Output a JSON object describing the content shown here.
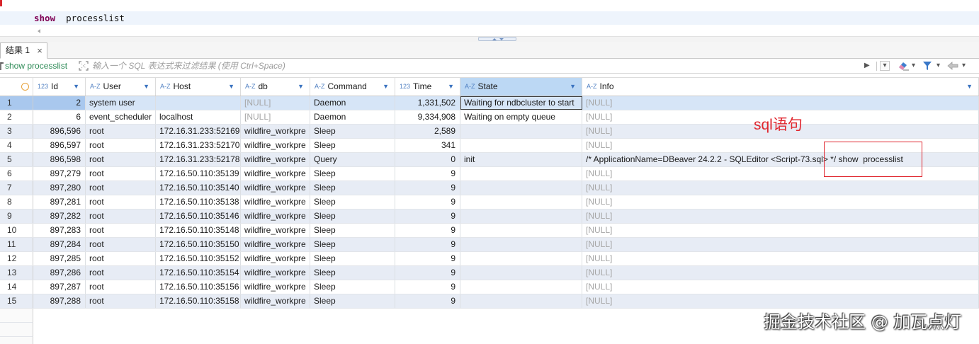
{
  "editor": {
    "keyword": "show",
    "rest": "  processlist"
  },
  "results_tab": {
    "label": "结果 1"
  },
  "filter_bar": {
    "query_label": "show processlist",
    "placeholder": "输入一个 SQL 表达式来过滤结果 (使用 Ctrl+Space)",
    "left_icons": [
      "query-source-icon",
      "expand-filter-icon"
    ],
    "right_icons": [
      "apply-filter-icon",
      "filter-history-dropdown-icon",
      "clear-filter-icon",
      "filter-settings-icon",
      "navigate-back-icon"
    ]
  },
  "grid": {
    "row_selector_icon": "circle-icon",
    "columns": [
      {
        "type_icon": "123",
        "label": "Id"
      },
      {
        "type_icon": "A-Z",
        "label": "User"
      },
      {
        "type_icon": "A-Z",
        "label": "Host"
      },
      {
        "type_icon": "A-Z",
        "label": "db"
      },
      {
        "type_icon": "A-Z",
        "label": "Command"
      },
      {
        "type_icon": "123",
        "label": "Time"
      },
      {
        "type_icon": "A-Z",
        "label": "State",
        "focused": true
      },
      {
        "type_icon": "A-Z",
        "label": "Info"
      }
    ],
    "rows": [
      {
        "num": "1",
        "selected": true,
        "cells": [
          "2",
          "system user",
          "",
          "[NULL]",
          "Daemon",
          "1,331,502",
          "Waiting for ndbcluster to start",
          "[NULL]"
        ]
      },
      {
        "num": "2",
        "cells": [
          "6",
          "event_scheduler",
          "localhost",
          "[NULL]",
          "Daemon",
          "9,334,908",
          "Waiting on empty queue",
          "[NULL]"
        ]
      },
      {
        "num": "3",
        "cells": [
          "896,596",
          "root",
          "172.16.31.233:52169",
          "wildfire_workpre",
          "Sleep",
          "2,589",
          "",
          "[NULL]"
        ]
      },
      {
        "num": "4",
        "cells": [
          "896,597",
          "root",
          "172.16.31.233:52170",
          "wildfire_workpre",
          "Sleep",
          "341",
          "",
          "[NULL]"
        ]
      },
      {
        "num": "5",
        "cells": [
          "896,598",
          "root",
          "172.16.31.233:52178",
          "wildfire_workpre",
          "Query",
          "0",
          "init",
          "/* ApplicationName=DBeaver 24.2.2 - SQLEditor <Script-73.sql> */ show  processlist"
        ]
      },
      {
        "num": "6",
        "cells": [
          "897,279",
          "root",
          "172.16.50.110:35139",
          "wildfire_workpre",
          "Sleep",
          "9",
          "",
          "[NULL]"
        ]
      },
      {
        "num": "7",
        "cells": [
          "897,280",
          "root",
          "172.16.50.110:35140",
          "wildfire_workpre",
          "Sleep",
          "9",
          "",
          "[NULL]"
        ]
      },
      {
        "num": "8",
        "cells": [
          "897,281",
          "root",
          "172.16.50.110:35138",
          "wildfire_workpre",
          "Sleep",
          "9",
          "",
          "[NULL]"
        ]
      },
      {
        "num": "9",
        "cells": [
          "897,282",
          "root",
          "172.16.50.110:35146",
          "wildfire_workpre",
          "Sleep",
          "9",
          "",
          "[NULL]"
        ]
      },
      {
        "num": "10",
        "cells": [
          "897,283",
          "root",
          "172.16.50.110:35148",
          "wildfire_workpre",
          "Sleep",
          "9",
          "",
          "[NULL]"
        ]
      },
      {
        "num": "11",
        "cells": [
          "897,284",
          "root",
          "172.16.50.110:35150",
          "wildfire_workpre",
          "Sleep",
          "9",
          "",
          "[NULL]"
        ]
      },
      {
        "num": "12",
        "cells": [
          "897,285",
          "root",
          "172.16.50.110:35152",
          "wildfire_workpre",
          "Sleep",
          "9",
          "",
          "[NULL]"
        ]
      },
      {
        "num": "13",
        "cells": [
          "897,286",
          "root",
          "172.16.50.110:35154",
          "wildfire_workpre",
          "Sleep",
          "9",
          "",
          "[NULL]"
        ]
      },
      {
        "num": "14",
        "cells": [
          "897,287",
          "root",
          "172.16.50.110:35156",
          "wildfire_workpre",
          "Sleep",
          "9",
          "",
          "[NULL]"
        ]
      },
      {
        "num": "15",
        "cells": [
          "897,288",
          "root",
          "172.16.50.110:35158",
          "wildfire_workpre",
          "Sleep",
          "9",
          "",
          "[NULL]"
        ]
      }
    ]
  },
  "annotation": {
    "label": "sql语句"
  },
  "watermark": "掘金技术社区 @ 加瓦点灯",
  "colors": {
    "keyword": "#7f0055",
    "current-line": "#eef4fc",
    "filter-query": "#2e8b57",
    "null-text": "#a6a6a6",
    "row-alt": "#e7ecf5",
    "row-selected": "#d6e5f7",
    "cell-selected": "#a9c8ee",
    "header-focused": "#bcd8f4",
    "type-icon": "#4f7fc2",
    "annotation": "#e0262e"
  }
}
